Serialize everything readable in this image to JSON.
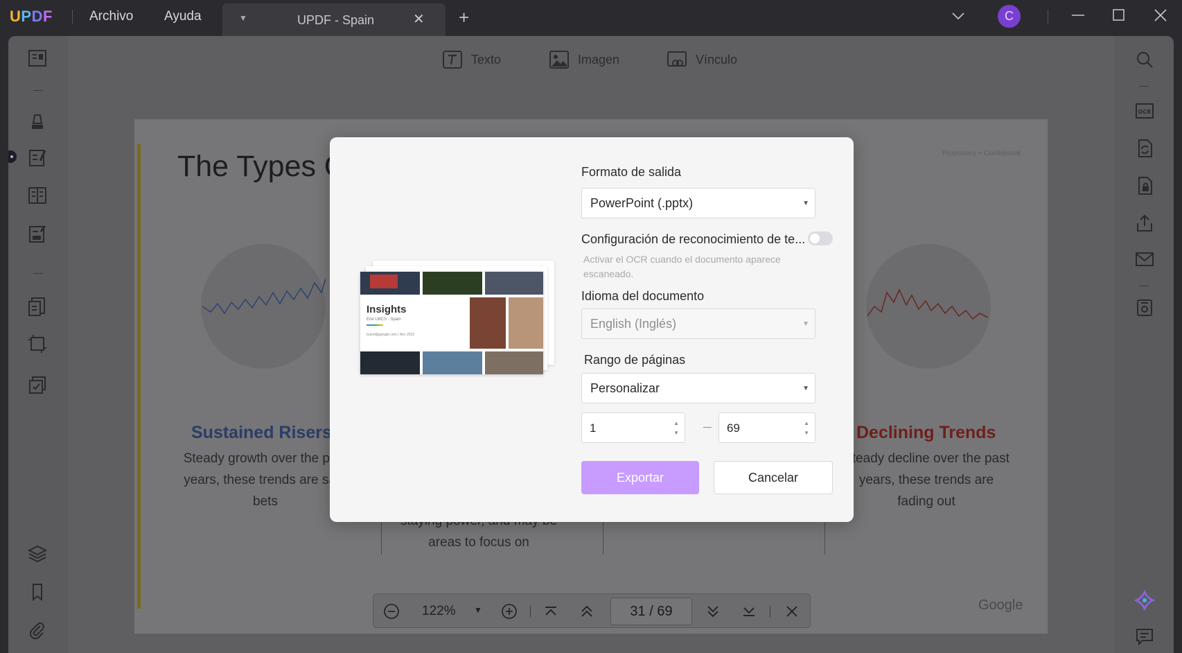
{
  "app": {
    "logo": {
      "u": "U",
      "p": "P",
      "d": "D",
      "f": "F"
    },
    "menu": [
      "Archivo",
      "Ayuda"
    ],
    "tab_title": "UPDF - Spain",
    "avatar_letter": "C"
  },
  "toolbar": {
    "text_label": "Texto",
    "image_label": "Imagen",
    "link_label": "Vínculo"
  },
  "page": {
    "title": "The Types O",
    "confidential": "Proprietary + Confidential",
    "left_heading": "Sustained Risers",
    "left_text": "Steady growth over the past years, these trends are safe bets",
    "middle_text": "staying power, and may be areas to focus on",
    "right_heading": "Declining Trends",
    "right_text": "Steady decline over the past years, these trends are fading out",
    "footer_logo": "Google"
  },
  "navigation": {
    "zoom": "122%",
    "current_page": "31",
    "separator": "/",
    "total_pages": "69"
  },
  "dialog": {
    "format_label": "Formato de salida",
    "format_value": "PowerPoint (.pptx)",
    "ocr_label": "Configuración de reconocimiento de te...",
    "ocr_enabled": false,
    "ocr_hint": "Activar el OCR cuando el documento aparece escaneado.",
    "language_label": "Idioma del documento",
    "language_value": "English (Inglés)",
    "range_label": "Rango de páginas",
    "range_value": "Personalizar",
    "range_from": "1",
    "range_to": "69",
    "export_button": "Exportar",
    "cancel_button": "Cancelar",
    "preview": {
      "title": "Insights",
      "subtitle": "Ene LMCS - Spain",
      "footnote": "brand@google.com | Nov 2023"
    }
  },
  "colors": {
    "accent": "#c79bff",
    "avatar": "#7a3fd1",
    "heading_blue": "#2b3d66",
    "heading_red": "#6e1f1c"
  }
}
